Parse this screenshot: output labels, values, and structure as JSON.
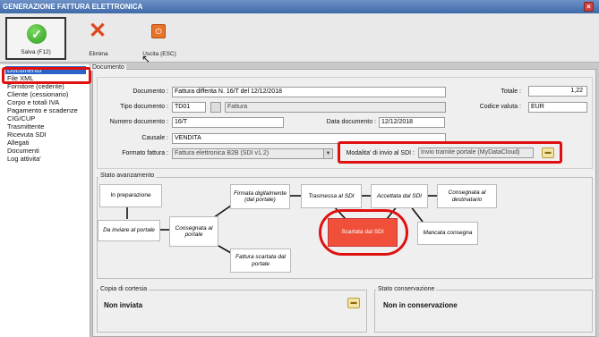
{
  "window": {
    "title": "GENERAZIONE FATTURA ELETTRONICA"
  },
  "toolbar": {
    "save_label": "Salva (F12)",
    "delete_label": "Elimina",
    "exit_label": "Uscita (ESC)"
  },
  "sidebar": {
    "items": [
      {
        "label": "Documento"
      },
      {
        "label": "File XML"
      },
      {
        "label": "Fornitore (cedente)"
      },
      {
        "label": "Cliente (cessionario)"
      },
      {
        "label": "Corpo e totali IVA"
      },
      {
        "label": "Pagamento e scadenze"
      },
      {
        "label": "CIG/CUP"
      },
      {
        "label": "Trasmittente"
      },
      {
        "label": "Ricevuta SDI"
      },
      {
        "label": "Allegati"
      },
      {
        "label": "Documenti"
      },
      {
        "label": "Log attivita'"
      }
    ]
  },
  "documento": {
    "section_title": "Documento",
    "documento_label": "Documento :",
    "documento_value": "Fattura differita N. 16/T del 12/12/2018",
    "tipo_label": "Tipo documento :",
    "tipo_code": "TD01",
    "tipo_desc": "Fattura",
    "numero_label": "Numero documento :",
    "numero_value": "16/T",
    "data_label": "Data documento :",
    "data_value": "12/12/2018",
    "causale_label": "Causale :",
    "causale_value": "VENDITA",
    "formato_label": "Formato fattura :",
    "formato_value": "Fattura elettronica B2B (SDI v1.2)",
    "modalita_label": "Modalita' di invio al SDI :",
    "modalita_value": "Invio tramite portale (MyDataCloud)",
    "totale_label": "Totale :",
    "totale_value": "1,22",
    "valuta_label": "Codice valuta :",
    "valuta_value": "EUR"
  },
  "stato": {
    "section_title": "Stato avanzamento",
    "nodes": {
      "preparazione": "In preparazione",
      "da_inviare": "Da inviare al portale",
      "consegnata_portale": "Consegnata al portale",
      "firmata": "Firmata digitalmente (dal portale)",
      "scartata_portale": "Fattura scartata dal portale",
      "trasmessa": "Trasmessa al SDI",
      "accettata": "Accettata dal SDI",
      "consegnata_dest": "Consegnata al destinatario",
      "scartata_sdi": "Scartata dal SDI",
      "mancata": "Mancata consegna"
    }
  },
  "copia": {
    "section_title": "Copia di cortesia",
    "value": "Non inviata"
  },
  "conservazione": {
    "section_title": "Stato conservazione",
    "value": "Non in conservazione"
  },
  "colors": {
    "highlight_red": "#e01010",
    "node_error": "#f0503a",
    "selection_blue": "#2a64c9"
  }
}
